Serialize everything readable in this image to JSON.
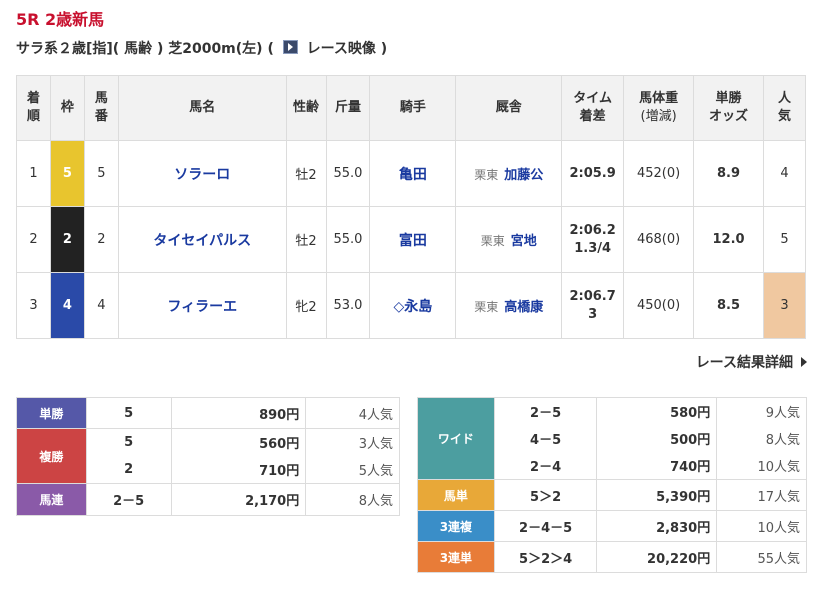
{
  "race": {
    "title": "5R 2歳新馬",
    "subtitle_prefix": "サラ系２歳[指]( 馬齢 ) 芝2000m(左)  (",
    "video_link": "レース映像",
    "subtitle_suffix": ")"
  },
  "results_table": {
    "headers": {
      "rank": [
        "着",
        "順"
      ],
      "frame": "枠",
      "num": [
        "馬",
        "番"
      ],
      "horse": "馬名",
      "sexage": "性齢",
      "weight": "斤量",
      "jockey": "騎手",
      "trainer": "厩舎",
      "time": [
        "タイム",
        "着差"
      ],
      "body": [
        "馬体重",
        "(増減)"
      ],
      "odds": [
        "単勝",
        "オッズ"
      ],
      "pop": [
        "人",
        "気"
      ]
    },
    "rows": [
      {
        "rank": "1",
        "frame": "5",
        "num": "5",
        "horse": "ソラーロ",
        "sexage": "牡2",
        "weight": "55.0",
        "jockey": "亀田",
        "area": "栗東",
        "trainer": "加藤公",
        "time": "2:05.9",
        "margin": "",
        "body": "452(0)",
        "odds": "8.9",
        "pop": "4"
      },
      {
        "rank": "2",
        "frame": "2",
        "num": "2",
        "horse": "タイセイパルス",
        "sexage": "牡2",
        "weight": "55.0",
        "jockey": "富田",
        "area": "栗東",
        "trainer": "宮地",
        "time": "2:06.2",
        "margin": "1.3/4",
        "body": "468(0)",
        "odds": "12.0",
        "pop": "5"
      },
      {
        "rank": "3",
        "frame": "4",
        "num": "4",
        "horse": "フィラーエ",
        "sexage": "牝2",
        "weight": "53.0",
        "jockey": "◇永島",
        "area": "栗東",
        "trainer": "高橋康",
        "time": "2:06.7",
        "margin": "3",
        "body": "450(0)",
        "odds": "8.5",
        "pop": "3"
      }
    ]
  },
  "detail_link": "レース結果詳細",
  "payouts_left": {
    "tansho": {
      "label": "単勝",
      "nums": "5",
      "amount": "890円",
      "pop": "4人気"
    },
    "fukusho": {
      "label": "複勝",
      "entries": [
        {
          "nums": "5",
          "amount": "560円",
          "pop": "3人気"
        },
        {
          "nums": "2",
          "amount": "710円",
          "pop": "5人気"
        }
      ]
    },
    "umaren": {
      "label": "馬連",
      "nums": "2－5",
      "amount": "2,170円",
      "pop": "8人気"
    }
  },
  "payouts_right": {
    "wide": {
      "label": "ワイド",
      "entries": [
        {
          "nums": "2－5",
          "amount": "580円",
          "pop": "9人気"
        },
        {
          "nums": "4－5",
          "amount": "500円",
          "pop": "8人気"
        },
        {
          "nums": "2－4",
          "amount": "740円",
          "pop": "10人気"
        }
      ]
    },
    "umatan": {
      "label": "馬単",
      "nums": "5＞2",
      "amount": "5,390円",
      "pop": "17人気"
    },
    "sanrenpuku": {
      "label": "3連複",
      "nums": "2－4－5",
      "amount": "2,830円",
      "pop": "10人気"
    },
    "sanrentan": {
      "label": "3連単",
      "nums": "5＞2＞4",
      "amount": "20,220円",
      "pop": "55人気"
    }
  },
  "colors": {
    "tansho": "#5558a8",
    "fukusho": "#cc4444",
    "umaren": "#8a5aa8",
    "wide": "#4c9ea0",
    "umatan": "#e8a838",
    "sanrenpuku": "#3a8ec8",
    "sanrentan": "#e87c38"
  }
}
